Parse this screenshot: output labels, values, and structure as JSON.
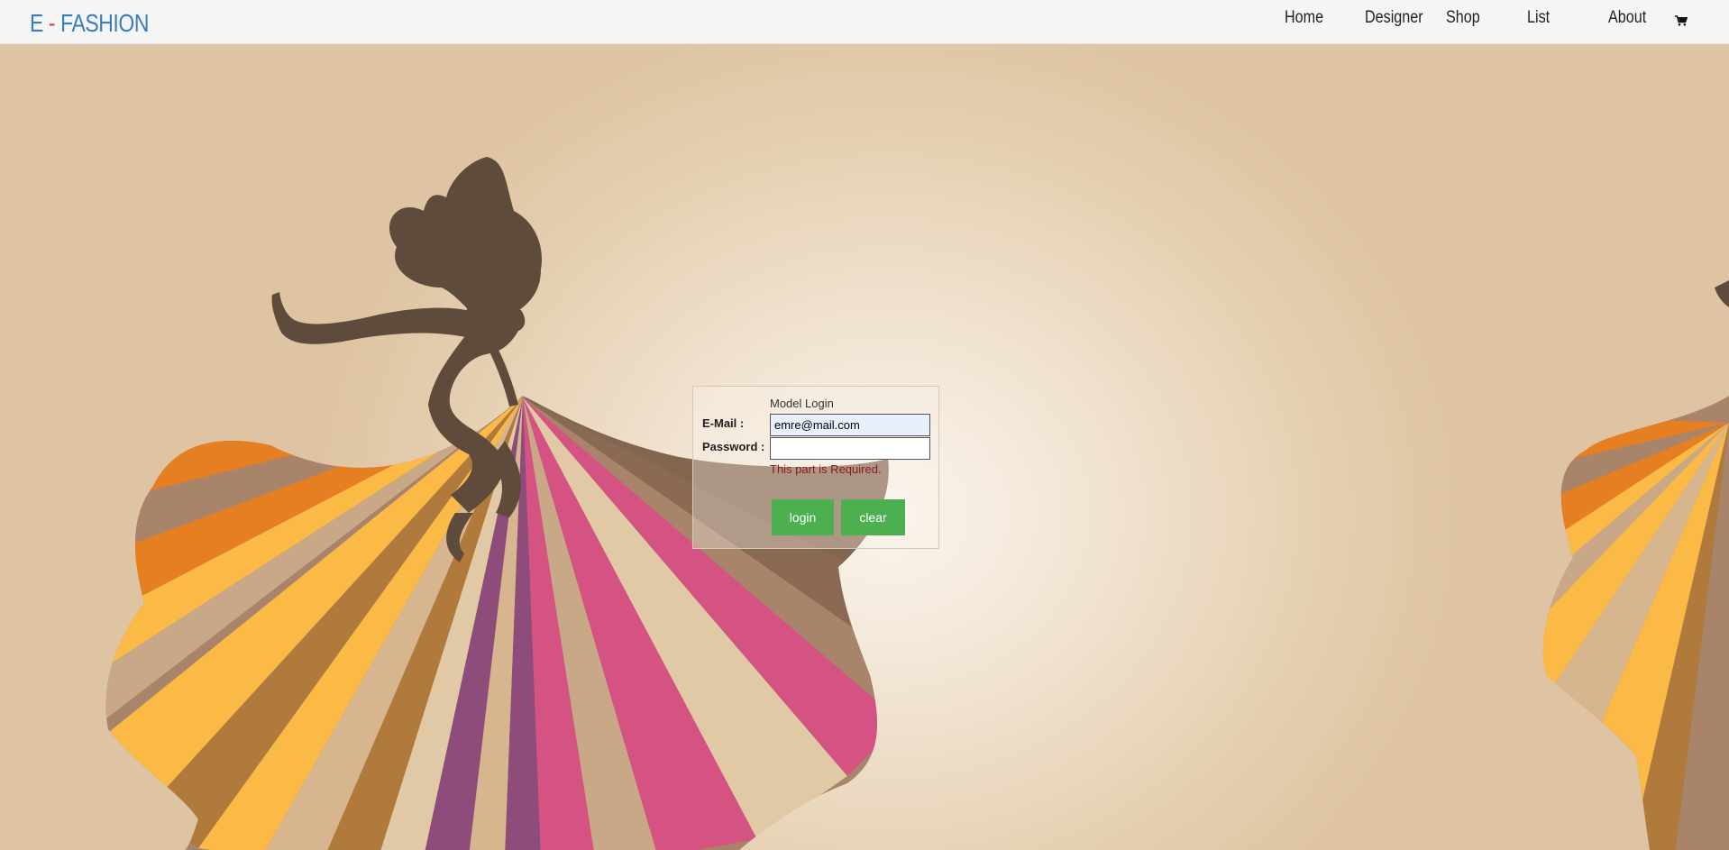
{
  "brand": {
    "part1": "E",
    "dash": "-",
    "part2": "FASHION"
  },
  "nav": {
    "items": [
      {
        "label": "Home"
      },
      {
        "label": "Designer"
      },
      {
        "label": "Shop"
      },
      {
        "label": "List"
      },
      {
        "label": "About"
      }
    ],
    "cart_icon": "shopping-cart-icon"
  },
  "login": {
    "title": "Model Login",
    "email_label": "E-Mail :",
    "email_value": "emre@mail.com",
    "password_label": "Password :",
    "password_value": "",
    "error_text": "This part is Required.",
    "login_button": "login",
    "clear_button": "clear"
  },
  "colors": {
    "brand": "#3a7dbf",
    "brand_dash": "#e23d3d",
    "button": "#4caf50",
    "error": "#8b1a1a",
    "silhouette": "#5e4b3c"
  }
}
